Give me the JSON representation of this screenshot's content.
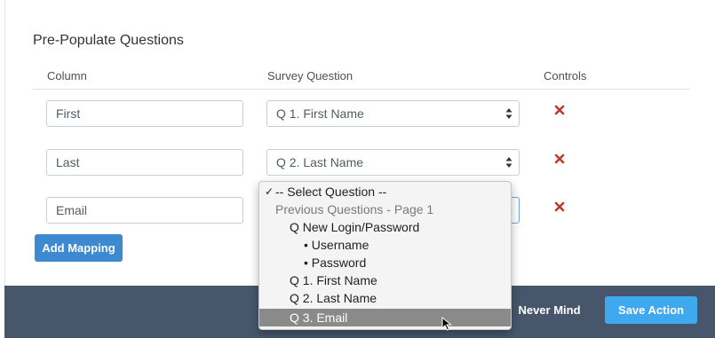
{
  "section": {
    "title": "Pre-Populate Questions"
  },
  "columns": {
    "column": "Column",
    "survey_question": "Survey Question",
    "controls": "Controls"
  },
  "rows": [
    {
      "column_value": "First",
      "question": "Q 1. First Name"
    },
    {
      "column_value": "Last",
      "question": "Q 2. Last Name"
    },
    {
      "column_value": "Email",
      "question": ""
    }
  ],
  "buttons": {
    "add_mapping": "Add Mapping",
    "never_mind": "Never Mind",
    "save_action": "Save Action"
  },
  "dropdown": {
    "options": [
      {
        "label": "-- Select Question --",
        "checked": true
      },
      {
        "label": "Previous Questions - Page 1",
        "group": true
      },
      {
        "label": "Q New Login/Password"
      },
      {
        "label": "• Username"
      },
      {
        "label": "• Password"
      },
      {
        "label": "Q 1. First Name"
      },
      {
        "label": "Q 2. Last Name"
      },
      {
        "label": "Q 3. Email",
        "highlighted": true
      }
    ],
    "check_glyph": "✓"
  },
  "colors": {
    "primary": "#3d8ad1",
    "save": "#3fa9ef",
    "footer": "#47566b",
    "delete": "#c0392b"
  }
}
